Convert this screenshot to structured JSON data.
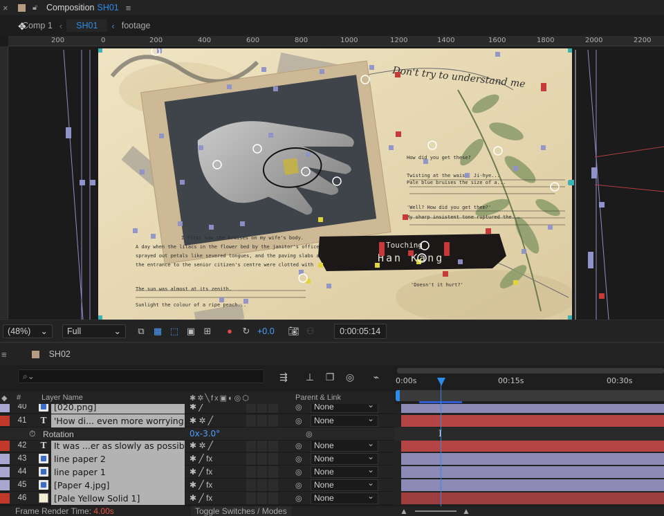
{
  "comp_panel": {
    "close": "×",
    "title": "Composition",
    "comp_name": "SH01",
    "menu": "≡"
  },
  "breadcrumb": {
    "items": [
      "Comp 1",
      "SH01",
      "footage"
    ]
  },
  "ruler": {
    "labels": [
      "200",
      "0",
      "200",
      "400",
      "600",
      "800",
      "1000",
      "1200",
      "1400",
      "1600",
      "1800",
      "2000",
      "2200"
    ]
  },
  "canvas_text": {
    "p1": "I first saw the bruises on my wife's body.",
    "p2": "A day when the lilacs in the flower bed by the janitor's office",
    "p3": "sprayed out petals like severed tongues, and the paving slabs at",
    "p4": "the entrance to the senior citizen's centre were clotted with",
    "p5": "The sun was almost at its zenith.",
    "p6": "Sunlight the colour of a ripe peach...",
    "r1": "How did you get these?",
    "r2": "Twisting at the waist, Ji-hye...",
    "r3": "Pale blue bruises the size of a...",
    "r4": "'Well? How did you get them?'",
    "r5": "My sharp insistent tone ruptured the...",
    "r6": "'Doesn't it hurt?'",
    "banner1": "Touching",
    "banner2": "Han Kang",
    "script": "Don't try to understand me"
  },
  "viewer_toolbar": {
    "zoom": "(48%)",
    "resolution": "Full",
    "exposure": "+0.0",
    "timecode": "0:00:05:14"
  },
  "timeline": {
    "comp_tab": "SH02",
    "search_placeholder": "",
    "time_labels": [
      "0:00s",
      "00:15s",
      "00:30s"
    ],
    "headers": {
      "label": "",
      "num": "#",
      "layer_name": "Layer Name",
      "parent_link": "Parent & Link"
    },
    "colors": {
      "red": "#c0392b",
      "lavender": "#a9a6cf",
      "tan": "#d9d3b0"
    },
    "layers": [
      {
        "num": "40",
        "name": "[020.png]",
        "type": "file",
        "color": "#a9a6cf",
        "parent": "None",
        "bar": "#8d8ab6",
        "fx": false
      },
      {
        "num": "41",
        "name": "'How di... even more worrying.'",
        "type": "text",
        "color": "#c0392b",
        "parent": "None",
        "bar": "#b54444",
        "fx": false
      },
      {
        "num": "42",
        "name": "It was ...er as slowly as possible.",
        "type": "text",
        "color": "#c0392b",
        "parent": "None",
        "bar": "#b54444",
        "fx": false
      },
      {
        "num": "43",
        "name": "line paper 2",
        "type": "file",
        "color": "#a9a6cf",
        "parent": "None",
        "bar": "#8d8ab6",
        "fx": true
      },
      {
        "num": "44",
        "name": "line paper 1",
        "type": "file",
        "color": "#a9a6cf",
        "parent": "None",
        "bar": "#8d8ab6",
        "fx": true
      },
      {
        "num": "45",
        "name": "[Paper 4.jpg]",
        "type": "file",
        "color": "#a9a6cf",
        "parent": "None",
        "bar": "#8d8ab6",
        "fx": true
      },
      {
        "num": "46",
        "name": "[Pale Yellow Solid 1]",
        "type": "solid",
        "color": "#c0392b",
        "parent": "None",
        "bar": "#9e3d3d",
        "fx": true
      }
    ],
    "rotation": {
      "label": "Rotation",
      "value": "0x-3.0°"
    }
  },
  "footer": {
    "frame_render_label": "Frame Render Time:",
    "frame_render_value": "4.00s",
    "toggle": "Toggle Switches / Modes"
  }
}
